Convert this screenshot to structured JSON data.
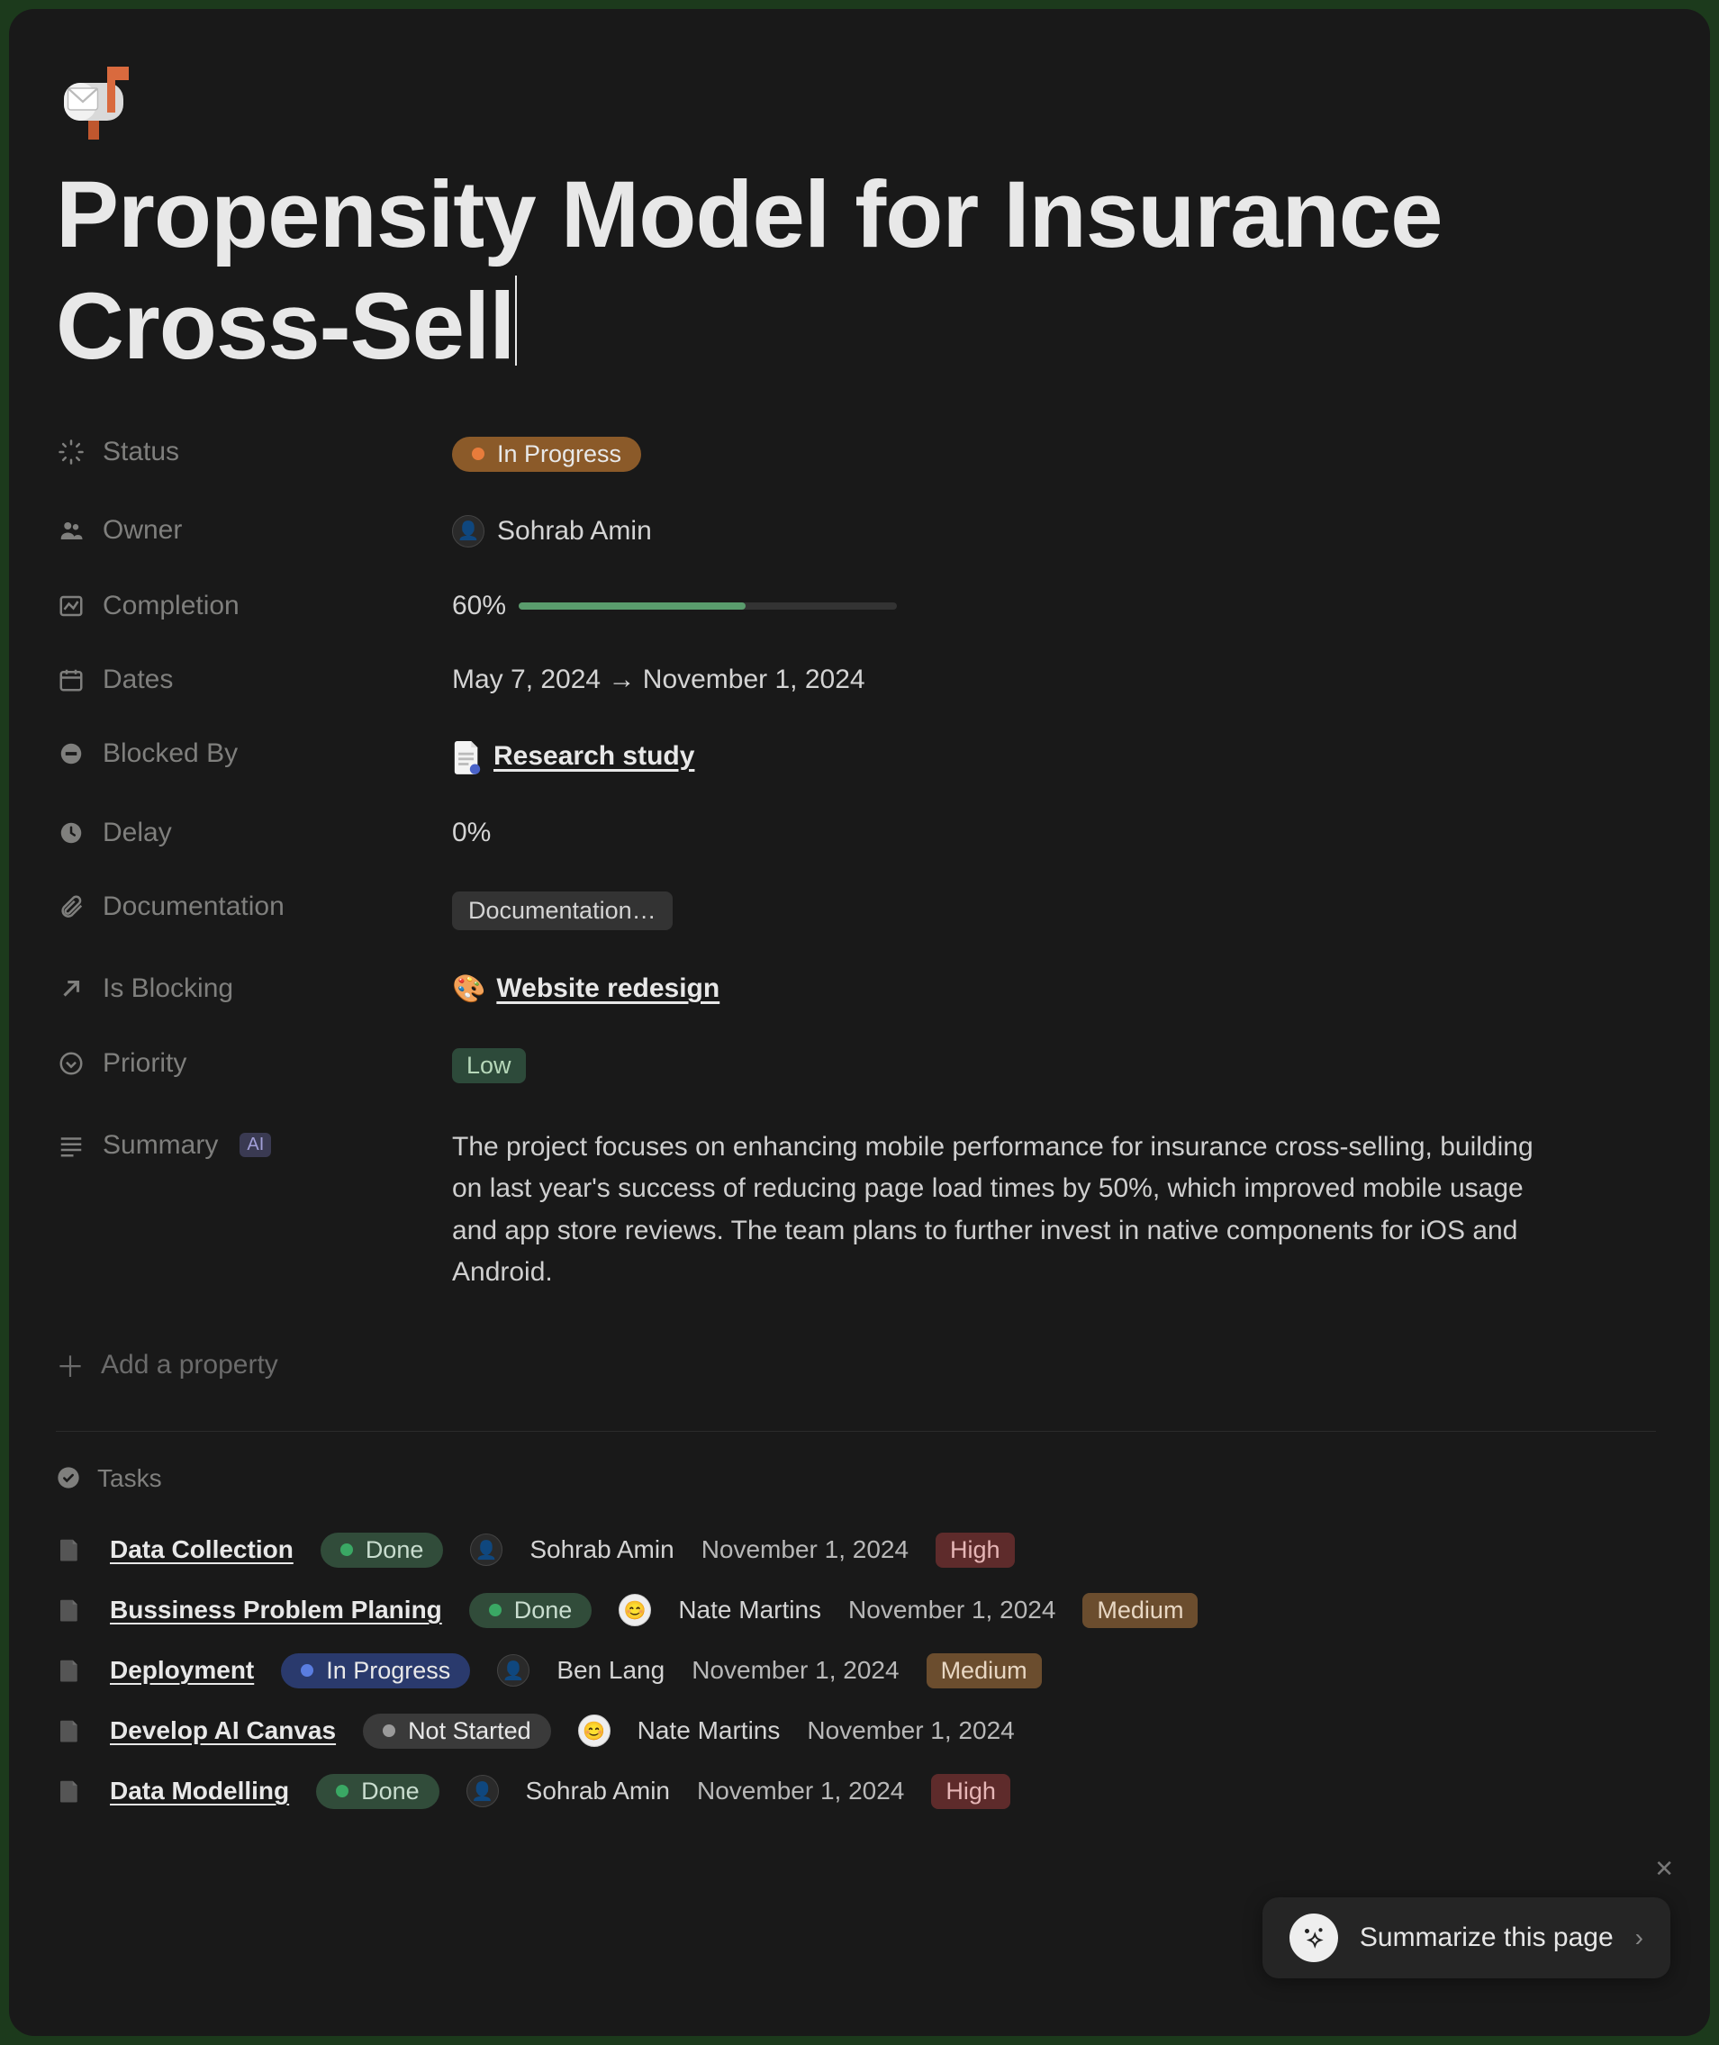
{
  "icon": "mailbox",
  "title": "Propensity Model for Insurance Cross-Sell",
  "properties": {
    "status": {
      "label": "Status",
      "value": "In Progress",
      "color": "orange"
    },
    "owner": {
      "label": "Owner",
      "name": "Sohrab Amin",
      "avatar": "sa"
    },
    "completion": {
      "label": "Completion",
      "percent_text": "60%",
      "percent": 60
    },
    "dates": {
      "label": "Dates",
      "text": "May 7, 2024 → November 1, 2024"
    },
    "blocked_by": {
      "label": "Blocked By",
      "page": "Research study",
      "page_icon": "doc"
    },
    "delay": {
      "label": "Delay",
      "value": "0%"
    },
    "documentation": {
      "label": "Documentation",
      "chip": "Documentation…"
    },
    "is_blocking": {
      "label": "Is Blocking",
      "page": "Website redesign",
      "page_icon": "palette"
    },
    "priority": {
      "label": "Priority",
      "value": "Low",
      "color": "green"
    },
    "summary": {
      "label": "Summary",
      "ai_badge": "AI",
      "text": "The project focuses on enhancing mobile performance for insurance cross-selling, building on last year's success of reducing page load times by 50%, which improved mobile usage and app store reviews. The team plans to further invest in native components for iOS and Android."
    }
  },
  "add_property_label": "Add a property",
  "tasks_header": "Tasks",
  "tasks": [
    {
      "title": "Data Collection",
      "status": "Done",
      "status_color": "green",
      "assignee": "Sohrab Amin",
      "assignee_avatar": "sa",
      "date": "November 1, 2024",
      "priority": "High",
      "priority_color": "red"
    },
    {
      "title": "Bussiness Problem Planing",
      "status": "Done",
      "status_color": "green",
      "assignee": "Nate Martins",
      "assignee_avatar": "nm",
      "date": "November 1, 2024",
      "priority": "Medium",
      "priority_color": "brown"
    },
    {
      "title": "Deployment",
      "status": "In Progress",
      "status_color": "blue",
      "assignee": "Ben Lang",
      "assignee_avatar": "sa",
      "date": "November 1, 2024",
      "priority": "Medium",
      "priority_color": "brown"
    },
    {
      "title": "Develop AI Canvas",
      "status": "Not Started",
      "status_color": "gray",
      "assignee": "Nate Martins",
      "assignee_avatar": "nm",
      "date": "November 1, 2024",
      "priority": "",
      "priority_color": ""
    },
    {
      "title": "Data Modelling",
      "status": "Done",
      "status_color": "green",
      "assignee": "Sohrab Amin",
      "assignee_avatar": "sa",
      "date": "November 1, 2024",
      "priority": "High",
      "priority_color": "red"
    }
  ],
  "summarize_button": "Summarize this page"
}
